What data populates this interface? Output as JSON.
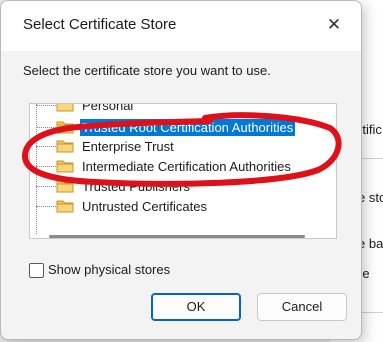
{
  "dialog": {
    "title": "Select Certificate Store",
    "close_glyph": "✕",
    "prompt": "Select the certificate store you want to use.",
    "stores": [
      {
        "label": "Personal",
        "selected": false
      },
      {
        "label": "Trusted Root Certification Authorities",
        "selected": true
      },
      {
        "label": "Enterprise Trust",
        "selected": false
      },
      {
        "label": "Intermediate Certification Authorities",
        "selected": false
      },
      {
        "label": "Trusted Publishers",
        "selected": false
      },
      {
        "label": "Untrusted Certificates",
        "selected": false
      }
    ],
    "show_physical_label": "Show physical stores",
    "show_physical_checked": false,
    "ok_label": "OK",
    "cancel_label": "Cancel"
  },
  "background_window": {
    "fragments": [
      "rtific",
      "e sto",
      "e ba",
      "re"
    ]
  },
  "colors": {
    "selection": "#0078d7",
    "annotation": "#e0101a",
    "ok_border": "#0067c0",
    "folder": "#f5c655"
  },
  "icons": {
    "folder": "folder-icon",
    "close": "close-icon"
  }
}
